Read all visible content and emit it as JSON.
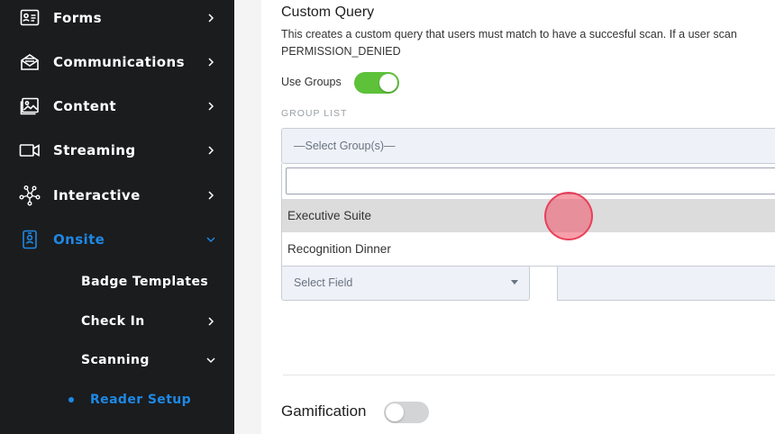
{
  "sidebar": {
    "items": [
      {
        "label": "Forms",
        "icon": "form-icon"
      },
      {
        "label": "Communications",
        "icon": "envelope-icon"
      },
      {
        "label": "Content",
        "icon": "image-icon"
      },
      {
        "label": "Streaming",
        "icon": "video-camera-icon"
      },
      {
        "label": "Interactive",
        "icon": "network-icon"
      },
      {
        "label": "Onsite",
        "icon": "badge-icon",
        "active": true
      }
    ],
    "sub_items": [
      {
        "label": "Badge Templates"
      },
      {
        "label": "Check In"
      },
      {
        "label": "Scanning"
      },
      {
        "label": "Reader Setup",
        "current": true
      }
    ],
    "colors": {
      "background": "#1b1c1e",
      "accent": "#1e88e5"
    }
  },
  "custom_query": {
    "title": "Custom Query",
    "description_line1": "This creates a custom query that users must match to have a succesful scan. If a user scan",
    "description_line2": "PERMISSION_DENIED",
    "use_groups_label": "Use Groups",
    "use_groups_on": true,
    "group_list_label": "GROUP LIST",
    "group_select_placeholder": "—Select Group(s)—",
    "search_value": "",
    "options": [
      {
        "label": "Executive Suite",
        "highlighted": true
      },
      {
        "label": "Recognition Dinner",
        "highlighted": false
      }
    ],
    "field_select_placeholder": "Select Field"
  },
  "gamification": {
    "label": "Gamification",
    "on": false
  },
  "colors": {
    "toggle_on": "#5ec13a",
    "toggle_off": "#d3d4d6",
    "highlight": "#dcdcdc"
  }
}
